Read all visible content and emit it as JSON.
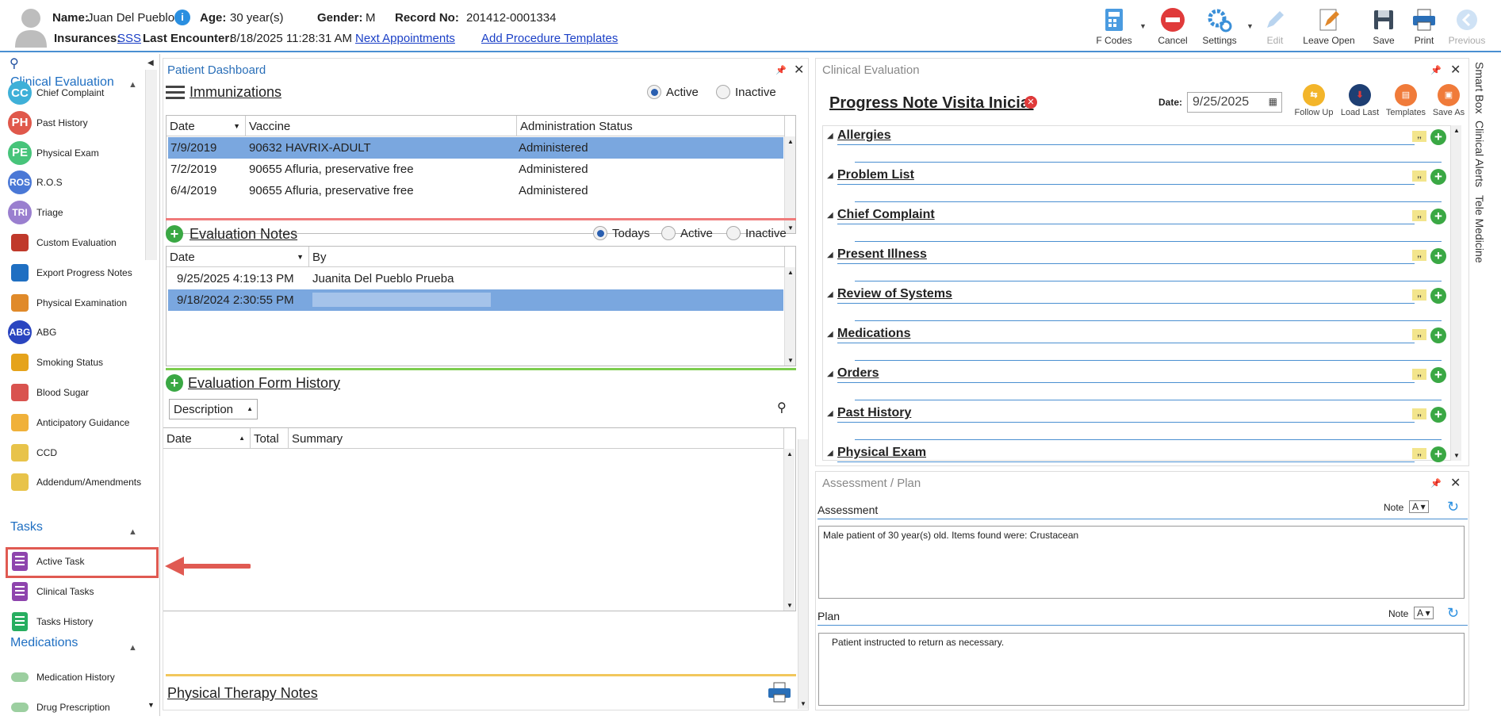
{
  "header": {
    "name_label": "Name:",
    "name": "Juan Del Pueblo",
    "age_label": "Age:",
    "age": "30 year(s)",
    "gender_label": "Gender:",
    "gender": "M",
    "record_label": "Record No:",
    "record": "201412-0001334",
    "insurances_label": "Insurances:",
    "insurance": "SSS",
    "last_encounter_label": "Last Encounter:",
    "last_encounter": "8/18/2025 11:28:31 AM",
    "next_appointments": "Next Appointments",
    "add_procedure_templates": "Add Procedure Templates"
  },
  "toolbar": {
    "fcodes": "F Codes",
    "cancel": "Cancel",
    "settings": "Settings",
    "edit": "Edit",
    "leave_open": "Leave Open",
    "save": "Save",
    "print": "Print",
    "previous": "Previous"
  },
  "sidebar": {
    "clinical_evaluation": "Clinical Evaluation",
    "items": [
      {
        "label": "Chief Complaint",
        "abbr": "CC",
        "color": "#3fb0d8"
      },
      {
        "label": "Past History",
        "abbr": "PH",
        "color": "#e0584b"
      },
      {
        "label": "Physical Exam",
        "abbr": "PE",
        "color": "#47c47a"
      },
      {
        "label": "R.O.S",
        "abbr": "ROS",
        "color": "#4a78d6"
      },
      {
        "label": "Triage",
        "abbr": "TRI",
        "color": "#9a7fcf"
      },
      {
        "label": "Custom Evaluation",
        "abbr": "",
        "color": "#c0392b"
      },
      {
        "label": "Export Progress Notes",
        "abbr": "",
        "color": "#1f6fc2"
      },
      {
        "label": "Physical Examination",
        "abbr": "",
        "color": "#e08a2a"
      },
      {
        "label": "ABG",
        "abbr": "ABG",
        "color": "#2a45c0"
      },
      {
        "label": "Smoking Status",
        "abbr": "",
        "color": "#e5a31b"
      },
      {
        "label": "Blood Sugar",
        "abbr": "",
        "color": "#d9534f"
      },
      {
        "label": "Anticipatory Guidance",
        "abbr": "",
        "color": "#f0b13a"
      },
      {
        "label": "CCD",
        "abbr": "",
        "color": "#e8c34a"
      },
      {
        "label": "Addendum/Amendments",
        "abbr": "",
        "color": "#e8c34a"
      }
    ],
    "tasks": "Tasks",
    "task_items": [
      {
        "label": "Active Task"
      },
      {
        "label": "Clinical Tasks"
      },
      {
        "label": "Tasks History"
      }
    ],
    "medications": "Medications",
    "med_items": [
      {
        "label": "Medication History"
      },
      {
        "label": "Drug Prescription"
      }
    ]
  },
  "dashboard": {
    "title": "Patient Dashboard",
    "immunizations": {
      "title": "Immunizations",
      "active": "Active",
      "inactive": "Inactive",
      "columns": [
        "Date",
        "Vaccine",
        "Administration Status"
      ],
      "rows": [
        {
          "date": "7/9/2019",
          "vaccine": "90632 HAVRIX-ADULT",
          "status": "Administered"
        },
        {
          "date": "7/2/2019",
          "vaccine": "90655 Afluria, preservative free",
          "status": "Administered"
        },
        {
          "date": "6/4/2019",
          "vaccine": "90655 Afluria, preservative free",
          "status": "Administered"
        }
      ]
    },
    "eval_notes": {
      "title": "Evaluation Notes",
      "todays": "Todays",
      "active": "Active",
      "inactive": "Inactive",
      "columns": [
        "Date",
        "By"
      ],
      "rows": [
        {
          "date": "9/25/2025 4:19:13 PM",
          "by": "Juanita Del Pueblo Prueba"
        },
        {
          "date": "9/18/2024 2:30:55 PM",
          "by": ""
        }
      ]
    },
    "form_history": {
      "title": "Evaluation Form History",
      "filter": "Description",
      "columns": [
        "Date",
        "Total",
        "Summary"
      ]
    },
    "pt_notes": "Physical Therapy Notes"
  },
  "clinical": {
    "title": "Clinical Evaluation",
    "note_title": "Progress Note Visita Inicial",
    "date_label": "Date:",
    "date": "9/25/2025",
    "follow_up": "Follow Up",
    "load_last": "Load Last",
    "templates": "Templates",
    "save_as": "Save As",
    "sections": [
      "Allergies",
      "Problem List",
      "Chief Complaint",
      "Present Illness",
      "Review of Systems",
      "Medications",
      "Orders",
      "Past History",
      "Physical Exam"
    ]
  },
  "assessment": {
    "title": "Assessment / Plan",
    "assessment_label": "Assessment",
    "note": "Note",
    "assessment_text": "Male patient of 30 year(s) old. Items found were:  Crustacean",
    "plan_label": "Plan",
    "plan_text": "Patient instructed to return as necessary."
  },
  "right_tabs": [
    "Smart Box",
    "Clinical Alerts",
    "Tele Medicine"
  ]
}
